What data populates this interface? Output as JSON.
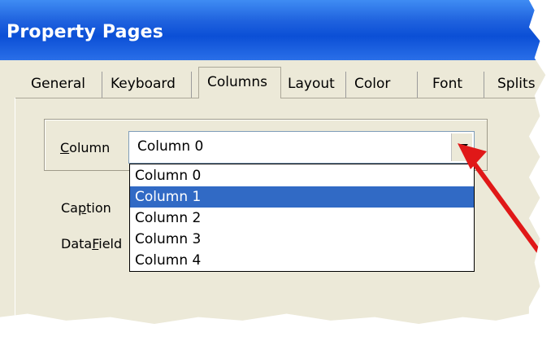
{
  "window": {
    "title": "Property Pages"
  },
  "tabs": [
    {
      "label": "General"
    },
    {
      "label": "Keyboard"
    },
    {
      "label": "Columns"
    },
    {
      "label": "Layout"
    },
    {
      "label": "Color"
    },
    {
      "label": "Font"
    },
    {
      "label": "Splits"
    }
  ],
  "active_tab": "Columns",
  "column_group": {
    "label_prefix": "",
    "label_mnemonic": "C",
    "label_rest": "olumn",
    "selected_value": "Column 0",
    "options": [
      "Column 0",
      "Column 1",
      "Column 2",
      "Column 3",
      "Column 4"
    ],
    "highlighted_option": "Column 1"
  },
  "fields": {
    "caption_prefix": "Ca",
    "caption_mnemonic": "p",
    "caption_rest": "tion",
    "datafield_prefix": "Data",
    "datafield_mnemonic": "F",
    "datafield_rest": "ield"
  },
  "colors": {
    "titlebar": "#0b4fd6",
    "dialog_bg": "#ece9d8",
    "selection": "#316ac5",
    "annotation_arrow": "#e01818"
  },
  "icons": {
    "combo_button": "chevron-down-icon",
    "annotation": "red-arrow-icon"
  }
}
